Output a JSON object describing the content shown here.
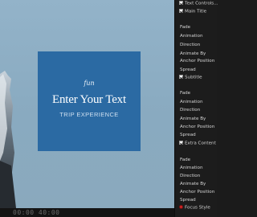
{
  "viewer": {
    "title_card": {
      "eyebrow": "fun",
      "main_title": "Enter Your Text",
      "subtitle": "TRIP EXPERIENCE"
    },
    "timecode": "00:00 40:00",
    "colors": {
      "card": "#2b6aa3",
      "sky": "#8cadc3"
    }
  },
  "inspector": {
    "top_checks": [
      {
        "label": "Text Controls...",
        "checked": true
      },
      {
        "label": "Main Title",
        "checked": true
      }
    ],
    "groups": [
      {
        "params": [
          "Fade",
          "Animation",
          "Direction",
          "Animate By",
          "Anchor Position",
          "Spread"
        ],
        "toggle": {
          "label": "Subtitle",
          "checked": true
        }
      },
      {
        "params": [
          "Fade",
          "Animation",
          "Direction",
          "Animate By",
          "Anchor Position",
          "Spread"
        ],
        "toggle": {
          "label": "Extra Content",
          "checked": true
        }
      },
      {
        "params": [
          "Fade",
          "Animation",
          "Direction",
          "Animate By",
          "Anchor Position",
          "Spread"
        ],
        "toggle": {
          "label": "Focus Style",
          "indicator": "red-dot-icon"
        }
      }
    ]
  }
}
